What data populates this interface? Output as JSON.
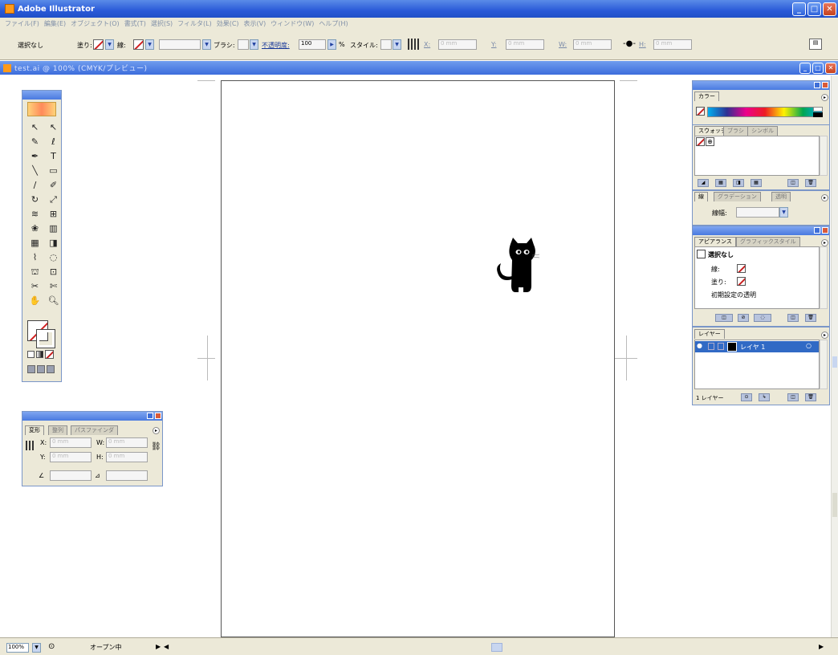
{
  "app": {
    "title": "Adobe Illustrator"
  },
  "menu": [
    "ファイル(F)",
    "編集(E)",
    "オブジェクト(O)",
    "書式(T)",
    "選択(S)",
    "フィルタ(L)",
    "効果(C)",
    "表示(V)",
    "ウィンドウ(W)",
    "ヘルプ(H)"
  ],
  "control": {
    "selection": "選択なし",
    "fill_label": "塗り:",
    "stroke_label": "線:",
    "brush_label": "ブラシ:",
    "opacity_label": "不透明度:",
    "opacity_value": "100",
    "percent": "%",
    "style_label": "スタイル:",
    "x_label": "X:",
    "y_label": "Y:",
    "w_label": "W:",
    "h_label": "H:",
    "zero_mm": "0 mm"
  },
  "document": {
    "title": "test.ai @ 100% (CMYK/プレビュー)"
  },
  "status": {
    "zoom": "100%",
    "text": "オープン中"
  },
  "color_panel": {
    "title": "カラー"
  },
  "swatches_panel": {
    "tabs": [
      "スウォッチ",
      "ブラシ",
      "シンボル"
    ]
  },
  "stroke_panel": {
    "tabs": [
      "線",
      "グラデーション",
      "透明"
    ],
    "weight_label": "線幅:"
  },
  "appearance_panel": {
    "tabs": [
      "アピアランス",
      "グラフィックスタイル"
    ],
    "selection": "選択なし",
    "stroke": "線:",
    "fill": "塗り:",
    "default_opacity": "初期設定の透明"
  },
  "layers_panel": {
    "title": "レイヤー",
    "layer_name": "レイヤ 1",
    "footer": "1 レイヤー"
  },
  "transform_panel": {
    "tabs": [
      "変形",
      "整列",
      "パスファインダ"
    ],
    "x_label": "X:",
    "y_label": "Y:",
    "w_label": "W:",
    "h_label": "H:",
    "zero_mm": "0 mm"
  },
  "colors": {
    "titlebar": "#2a5ad8",
    "chrome": "#ece9d8",
    "none_slash": "#d02020"
  }
}
